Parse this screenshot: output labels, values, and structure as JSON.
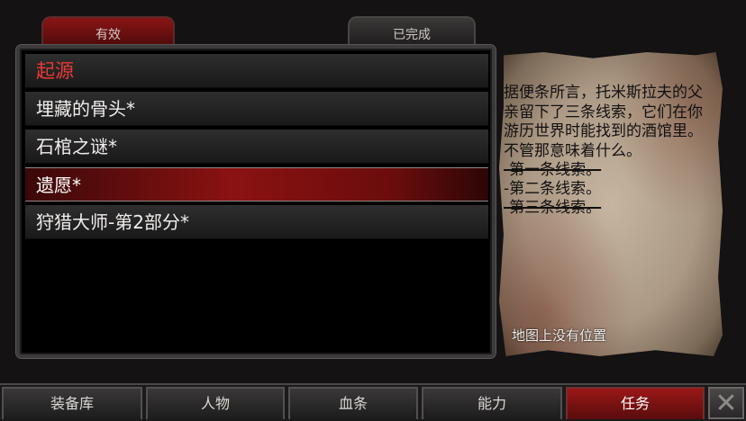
{
  "tabs": {
    "active_label": "有效",
    "completed_label": "已完成"
  },
  "quest_list": {
    "category": "起源",
    "items": [
      {
        "label": "埋藏的骨头*",
        "selected": false
      },
      {
        "label": "石棺之谜*",
        "selected": false
      },
      {
        "label": "遗愿*",
        "selected": true
      },
      {
        "label": "狩猎大师-第2部分*",
        "selected": false
      }
    ]
  },
  "quest_detail": {
    "description": "据便条所言，托米斯拉夫的父亲留下了三条线索，它们在你游历世界时能找到的酒馆里。 不管那意味着什么。",
    "clues": [
      {
        "text": "-第一条线索。",
        "completed": true
      },
      {
        "text": "-第二条线索。",
        "completed": false
      },
      {
        "text": "-第三条线索。",
        "completed": true
      }
    ],
    "location": "地图上没有位置"
  },
  "bottom_nav": {
    "items": [
      {
        "label": "装备库",
        "active": false
      },
      {
        "label": "人物",
        "active": false
      },
      {
        "label": "血条",
        "active": false
      },
      {
        "label": "能力",
        "active": false
      },
      {
        "label": "任务",
        "active": true
      }
    ],
    "close_icon": "close-icon"
  },
  "colors": {
    "accent_red": "#8b1212",
    "category_red": "#e83a36",
    "parchment": "#b8a691"
  }
}
